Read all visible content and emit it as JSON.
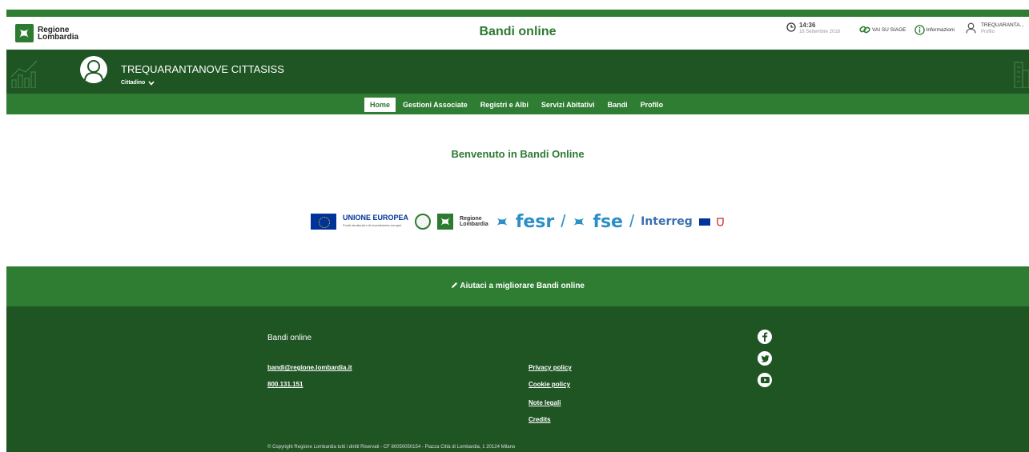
{
  "header": {
    "brand_line1": "Regione",
    "brand_line2": "Lombardia",
    "title": "Bandi online",
    "time": "14:36",
    "date": "18 Settembre 2018",
    "siage_link": "VAI SU SIAGE",
    "info_link": "Informazioni",
    "user_short": "TREQUARANTA...",
    "user_sub": "Profilo"
  },
  "userband": {
    "name": "TREQUARANTANOVE CITTASISS",
    "role": "Cittadino"
  },
  "nav": {
    "items": [
      {
        "label": "Home",
        "active": true
      },
      {
        "label": "Gestioni Associate"
      },
      {
        "label": "Registri e Albi"
      },
      {
        "label": "Servizi Abitativi"
      },
      {
        "label": "Bandi"
      },
      {
        "label": "Profilo"
      }
    ]
  },
  "main": {
    "welcome": "Benvenuto in Bandi Online",
    "logos": {
      "eu_title": "UNIONE EUROPEA",
      "eu_sub": "Fondi strutturali e di investimento europei",
      "rl_line1": "Regione",
      "rl_line2": "Lombardia",
      "fesr": "fesr",
      "fse": "fse",
      "slash": "/",
      "interreg": "Interreg"
    }
  },
  "feedback": {
    "label": "Aiutaci a migliorare Bandi online"
  },
  "footer": {
    "title": "Bandi online",
    "email": "bandi@regione.lombardia.it",
    "phone": "800.131.151",
    "privacy": "Privacy policy",
    "cookie": "Cookie policy",
    "legal": "Note legali",
    "credits": "Credits",
    "copyright": "© Copyright Regione Lombardia tutti i diritti Riservati - CF 80050050154 - Piazza Città di Lombardia, 1 20124 Milano"
  },
  "colors": {
    "brand_green": "#2f7d32",
    "dark_green": "#1f5523",
    "fund_blue": "#2c8fc7"
  }
}
